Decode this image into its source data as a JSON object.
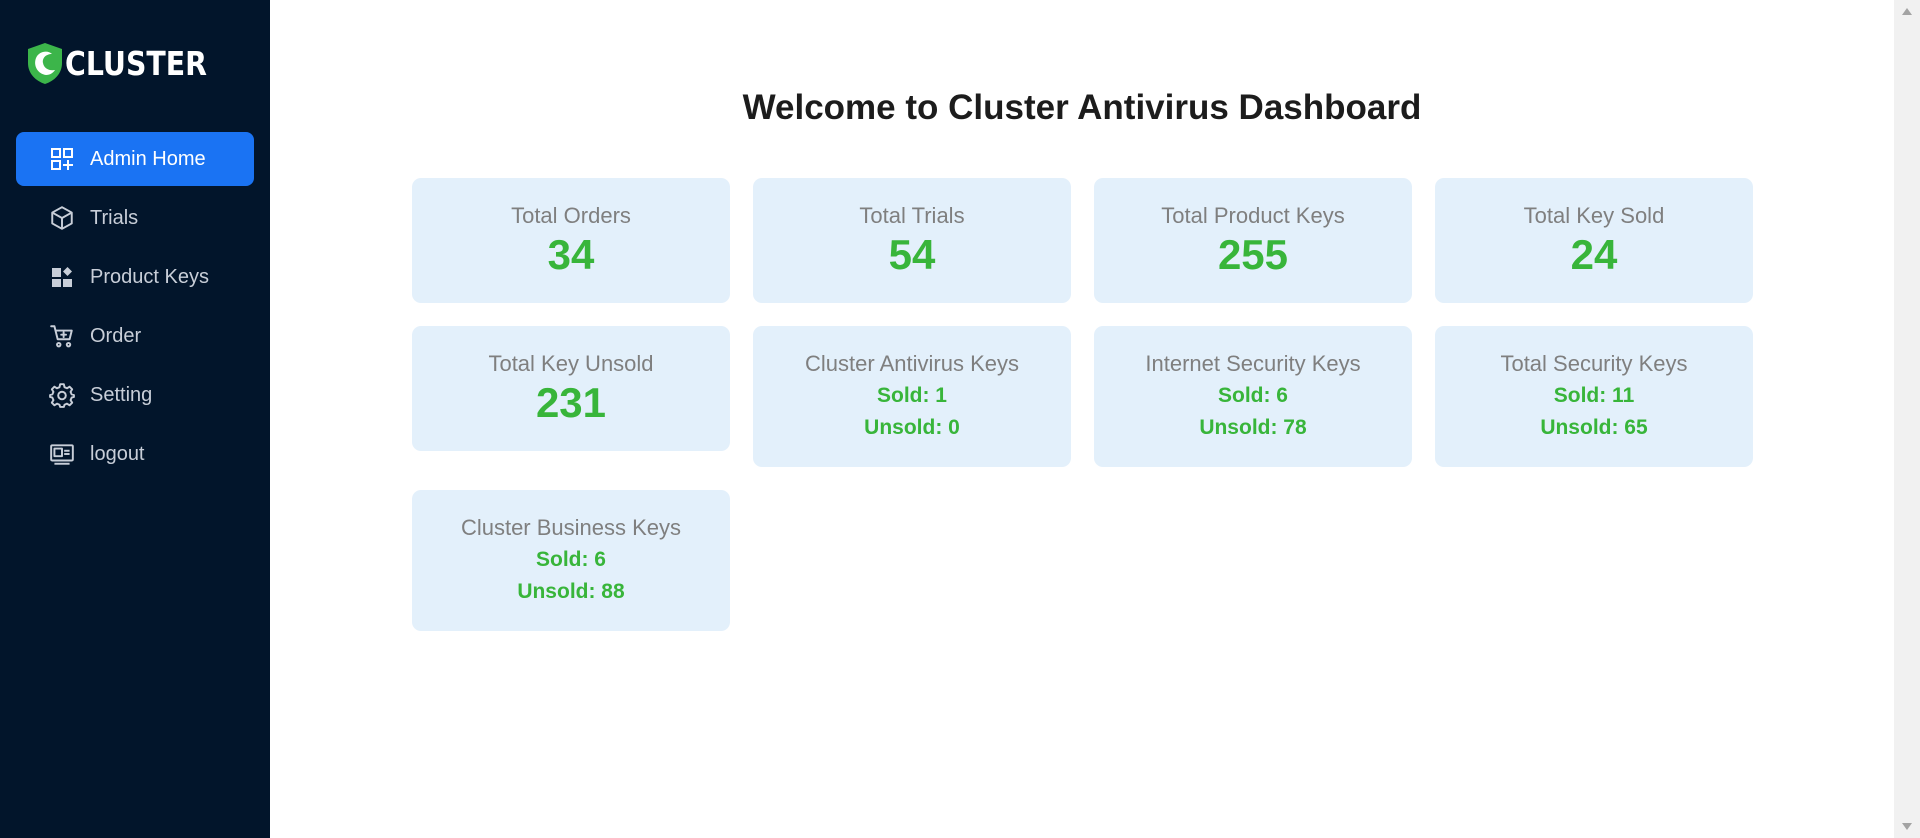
{
  "brand": {
    "name": "CLUSTER"
  },
  "sidebar": {
    "items": [
      {
        "label": "Admin Home",
        "icon": "dashboard-icon",
        "active": true
      },
      {
        "label": "Trials",
        "icon": "cube-icon",
        "active": false
      },
      {
        "label": "Product Keys",
        "icon": "widgets-icon",
        "active": false
      },
      {
        "label": "Order",
        "icon": "cart-icon",
        "active": false
      },
      {
        "label": "Setting",
        "icon": "gear-icon",
        "active": false
      },
      {
        "label": "logout",
        "icon": "logout-icon",
        "active": false
      }
    ]
  },
  "main": {
    "title": "Welcome to Cluster Antivirus Dashboard",
    "stats": [
      {
        "label": "Total Orders",
        "value": "34"
      },
      {
        "label": "Total Trials",
        "value": "54"
      },
      {
        "label": "Total Product Keys",
        "value": "255"
      },
      {
        "label": "Total Key Sold",
        "value": "24"
      },
      {
        "label": "Total Key Unsold",
        "value": "231"
      }
    ],
    "products": [
      {
        "label": "Cluster Antivirus Keys",
        "sold": "Sold: 1",
        "unsold": "Unsold: 0"
      },
      {
        "label": "Internet Security Keys",
        "sold": "Sold: 6",
        "unsold": "Unsold: 78"
      },
      {
        "label": "Total Security Keys",
        "sold": "Sold: 11",
        "unsold": "Unsold: 65"
      },
      {
        "label": "Cluster Business Keys",
        "sold": "Sold: 6",
        "unsold": "Unsold: 88"
      }
    ]
  },
  "colors": {
    "sidebar_bg": "#02152b",
    "active_item": "#1a73f3",
    "card_bg": "#e3f0fb",
    "value_green": "#38b53a"
  }
}
